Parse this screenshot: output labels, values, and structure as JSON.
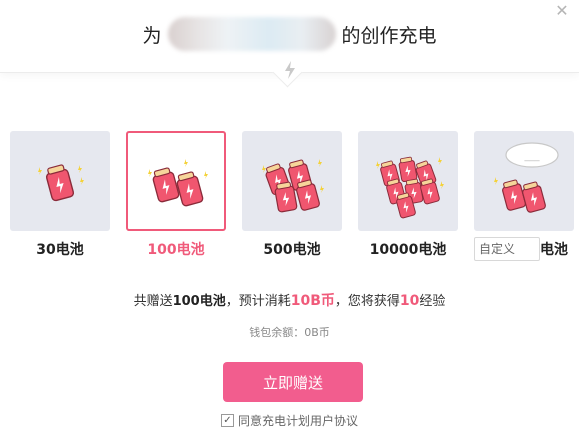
{
  "header": {
    "prefix": "为",
    "suffix": "的创作充电",
    "close_symbol": "✕"
  },
  "options": [
    {
      "label": "30电池",
      "batteries": 1
    },
    {
      "label": "100电池",
      "batteries": 2,
      "selected": true
    },
    {
      "label": "500电池",
      "batteries": 4
    },
    {
      "label": "10000电池",
      "batteries": 7
    }
  ],
  "custom": {
    "placeholder": "自定义",
    "unit": "电池",
    "bubble_text": "___"
  },
  "summary": {
    "part1": "共赠送",
    "amount": "100电池",
    "part2": "，预计消耗",
    "cost": "10B币",
    "part3": "，您将获得",
    "exp": "10",
    "part4": "经验"
  },
  "balance": "钱包余额：0B币",
  "submit_label": "立即赠送",
  "agreement": {
    "checked": true,
    "text": "同意充电计划用户协议"
  },
  "colors": {
    "accent": "#f25d8e",
    "highlight": "#f05a7a",
    "tile_bg": "#e6e8ef"
  }
}
